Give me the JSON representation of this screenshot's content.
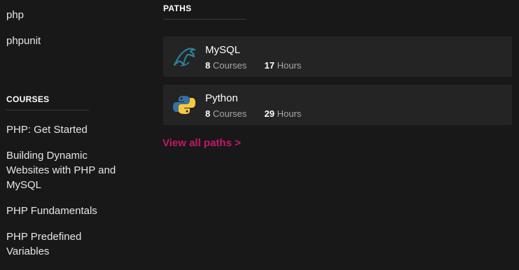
{
  "sidebar": {
    "tags": [
      "php",
      "phpunit"
    ],
    "courses_heading": "COURSES",
    "courses": [
      "PHP: Get Started",
      "Building Dynamic Websites with PHP and MySQL",
      "PHP Fundamentals",
      "PHP Predefined Variables"
    ]
  },
  "paths": {
    "heading": "PATHS",
    "items": [
      {
        "title": "MySQL",
        "courses_count": "8",
        "courses_label": "Courses",
        "hours_count": "17",
        "hours_label": "Hours",
        "icon": "mysql-dolphin-icon"
      },
      {
        "title": "Python",
        "courses_count": "8",
        "courses_label": "Courses",
        "hours_count": "29",
        "hours_label": "Hours",
        "icon": "python-logo-icon"
      }
    ],
    "view_all": "View all paths >"
  },
  "colors": {
    "background": "#181818",
    "card": "#242424",
    "accent": "#c4176a",
    "mysql_icon": "#2e7f9a",
    "python_blue": "#3771a1",
    "python_yellow": "#f7c93e"
  }
}
